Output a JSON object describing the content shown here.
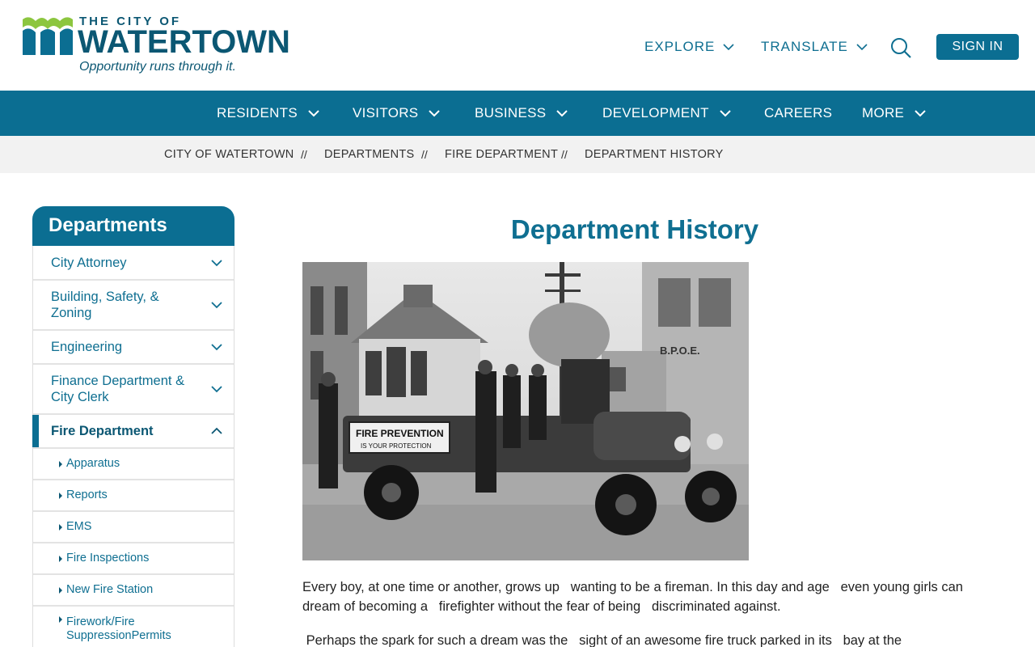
{
  "header": {
    "logo_the": "THE CITY OF",
    "logo_name": "WATERTOWN",
    "logo_tagline": "Opportunity runs through it.",
    "explore_label": "EXPLORE",
    "translate_label": "TRANSLATE",
    "search_icon": "search-icon",
    "signin_label": "SIGN IN"
  },
  "nav": {
    "items": [
      {
        "label": "RESIDENTS",
        "has_menu": true
      },
      {
        "label": "VISITORS",
        "has_menu": true
      },
      {
        "label": "BUSINESS",
        "has_menu": true
      },
      {
        "label": "DEVELOPMENT",
        "has_menu": true
      },
      {
        "label": "CAREERS",
        "has_menu": false
      },
      {
        "label": "MORE",
        "has_menu": true
      }
    ]
  },
  "breadcrumb": {
    "items": [
      "CITY OF WATERTOWN",
      "DEPARTMENTS",
      "FIRE DEPARTMENT",
      "DEPARTMENT HISTORY"
    ],
    "separator": "//"
  },
  "sidebar": {
    "title": "Departments",
    "items": [
      {
        "label": "City Attorney"
      },
      {
        "label": "Building, Safety, & Zoning"
      },
      {
        "label": "Engineering"
      },
      {
        "label": "Finance Department & City Clerk"
      },
      {
        "label": "Fire Department",
        "expanded": true
      }
    ],
    "subitems": [
      {
        "label": "Apparatus"
      },
      {
        "label": "Reports"
      },
      {
        "label": "EMS"
      },
      {
        "label": "Fire Inspections"
      },
      {
        "label": "New Fire Station"
      },
      {
        "label": "Firework/Fire SuppressionPermits"
      }
    ]
  },
  "main": {
    "title": "Department History",
    "photo_sign_1": "FIRE PREVENTION",
    "photo_sign_2": "IS YOUR PROTECTION",
    "photo_bpoe": "B.P.O.E.",
    "paragraph_1": "Every boy, at one time or another, grows up   wanting to be a fireman. In this day and age   even young girls can dream of becoming a   firefighter without the fear of being   discriminated against.",
    "paragraph_2": " Perhaps the spark for such a dream was the   sight of an awesome fire truck parked in its   bay at the"
  },
  "colors": {
    "brand_dark": "#0b5773",
    "brand": "#0b6e92",
    "link": "#0f6f91",
    "logo_green": "#8cc63f",
    "crumb_bg": "#f2f2f2"
  }
}
